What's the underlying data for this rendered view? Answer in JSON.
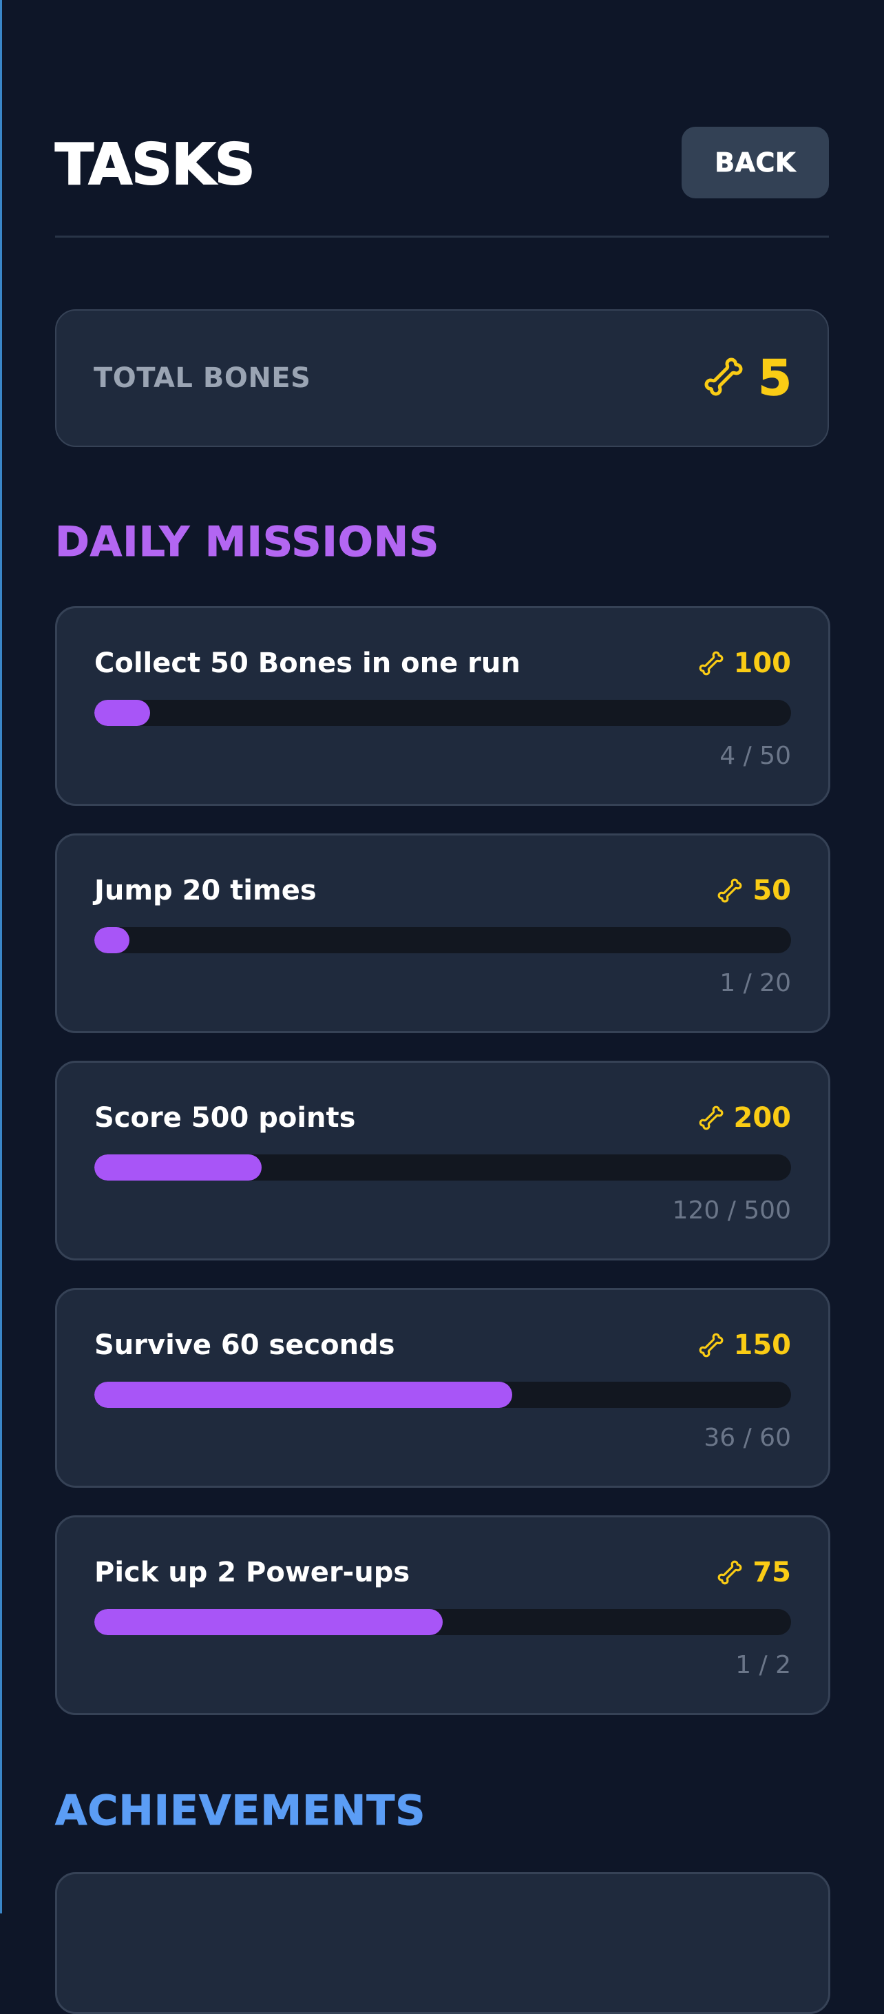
{
  "header": {
    "title": "TASKS",
    "back_label": "BACK"
  },
  "total": {
    "label": "TOTAL BONES",
    "value": "5",
    "icon": "bone-icon"
  },
  "sections": {
    "daily_missions": "DAILY MISSIONS",
    "achievements": "ACHIEVEMENTS"
  },
  "missions": [
    {
      "title": "Collect 50 Bones in one run",
      "reward": "100",
      "progress_text": "4 / 50",
      "progress": 0.08
    },
    {
      "title": "Jump 20 times",
      "reward": "50",
      "progress_text": "1 / 20",
      "progress": 0.05
    },
    {
      "title": "Score 500 points",
      "reward": "200",
      "progress_text": "120 / 500",
      "progress": 0.24
    },
    {
      "title": "Survive 60 seconds",
      "reward": "150",
      "progress_text": "36 / 60",
      "progress": 0.6
    },
    {
      "title": "Pick up 2 Power-ups",
      "reward": "75",
      "progress_text": "1 / 2",
      "progress": 0.5
    }
  ],
  "colors": {
    "background": "#0e1628",
    "card": "#1f2a3d",
    "accent_purple": "#a855f7",
    "accent_blue": "#5b9df5",
    "bone_yellow": "#facc15"
  }
}
